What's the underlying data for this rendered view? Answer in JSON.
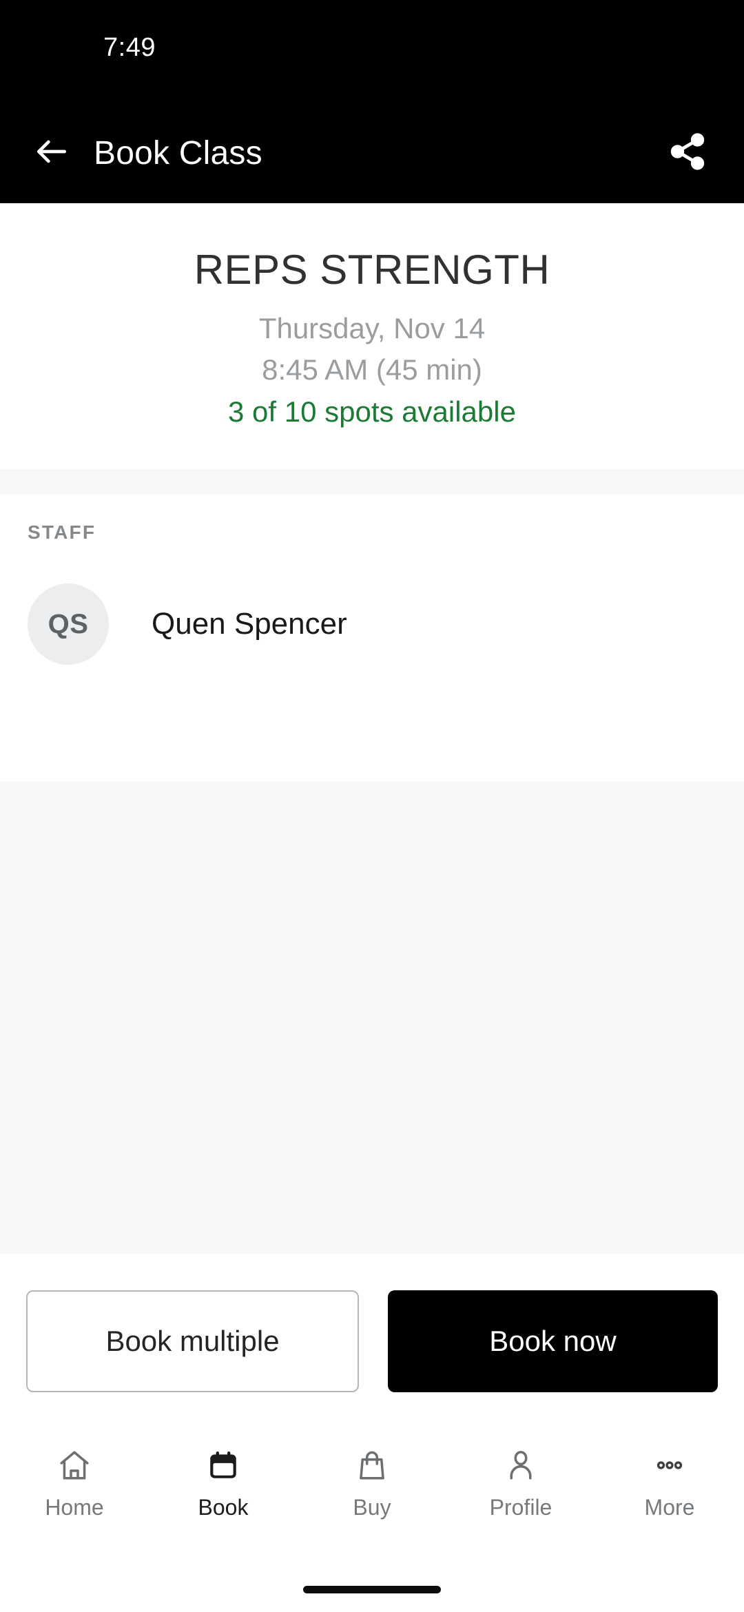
{
  "status_bar": {
    "clock": "7:49"
  },
  "app_bar": {
    "back_icon": "arrow-left-icon",
    "title": "Book Class",
    "share_icon": "share-icon"
  },
  "class": {
    "title": "REPS STRENGTH",
    "date": "Thursday, Nov 14",
    "time": "8:45 AM (45 min)",
    "spots": "3 of 10 spots available",
    "spots_color": "#1b7a34",
    "title_color": "#2f3133",
    "meta_color": "#9a9da0"
  },
  "staff": {
    "section_label": "STAFF",
    "members": [
      {
        "initials": "QS",
        "name": "Quen Spencer"
      }
    ]
  },
  "actions": {
    "secondary_label": "Book multiple",
    "primary_label": "Book now"
  },
  "bottom_nav": {
    "items": [
      {
        "label": "Home",
        "icon": "home-icon",
        "active": false
      },
      {
        "label": "Book",
        "icon": "calendar-icon",
        "active": true
      },
      {
        "label": "Buy",
        "icon": "shopping-bag-icon",
        "active": false
      },
      {
        "label": "Profile",
        "icon": "person-icon",
        "active": false
      },
      {
        "label": "More",
        "icon": "ellipsis-icon",
        "active": false
      }
    ]
  }
}
